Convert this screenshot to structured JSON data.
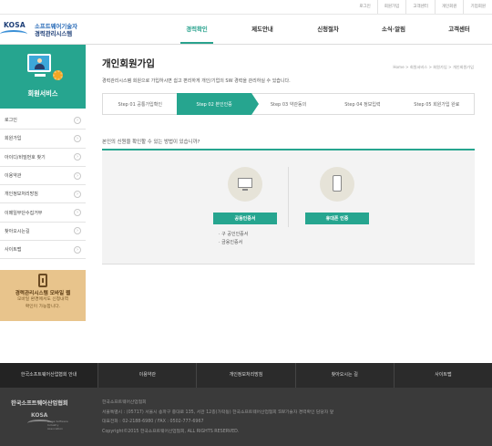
{
  "util_links": [
    "로그인",
    "회원가입",
    "고객센터",
    "개인회원",
    "기업회원"
  ],
  "logo": {
    "mark": "KOSA",
    "line1": "소프트웨어기술자",
    "line2": "경력관리시스템"
  },
  "gnb": [
    "경력확인",
    "제도안내",
    "신청절차",
    "소식·알림",
    "고객센터"
  ],
  "sidebar": {
    "title": "회원서비스",
    "items": [
      "로그인",
      "회원가입",
      "아이디/비밀번호 찾기",
      "이용약관",
      "개인정보처리방침",
      "이메일무단수집거부",
      "찾아오시는길",
      "사이트맵"
    ],
    "arrow": "›"
  },
  "banner": {
    "title": "경력관리시스템 모바일 웹",
    "line1": "모바일 환경에서도 신청내역",
    "line2": "확인이 가능합니다."
  },
  "content": {
    "title": "개인회원가입",
    "breadcrumb": "Home > 회원서비스 > 회원가입 > 개인회원가입",
    "intro": "경력관리시스템 회원으로 가입하시면 쉽고 편리하게 개인/기업의 SW 경력을 관리하실 수 있습니다.",
    "steps": [
      "Step 01 공통가입확인",
      "Step 02 본인인증",
      "Step 03 약관동의",
      "Step 04 정보입력",
      "Step 05 회원가입 완료"
    ],
    "active_step": 2,
    "question": "본인의 신원을 확인할 수 있는 방법이 있습니까?",
    "cert": {
      "button": "공동인증서",
      "notes": [
        "· 구 공인인증서",
        "· 금융인증서"
      ]
    },
    "phone": {
      "button": "휴대폰 인증"
    }
  },
  "footer": {
    "nav": [
      "한국소프트웨어산업협회 안내",
      "이용약관",
      "개인정보처리방침",
      "찾아오시는 길",
      "사이트맵"
    ],
    "org": "한국소프트웨어산업협회",
    "logo_mark": "KOSA",
    "logo_sub": "Korea Software Industry Association",
    "lines": [
      "한국소프트웨어산업협회",
      "서울특별시 : (05717) 서울시 송파구 중대로 135, 서관 12층(가락동) 한국소프트웨어산업협회 SW기술자 경력확인 담당자 앞",
      "대표전화 : 02-2188-6980 / FAX : 0502-777-6967",
      "Copyright©2015 한국소프트웨어산업협회, ALL RIGHTS RESERVED."
    ]
  },
  "colors": {
    "accent": "#26a58f",
    "dark_footer": "#2b2b2b",
    "banner": "#e8c48c"
  }
}
